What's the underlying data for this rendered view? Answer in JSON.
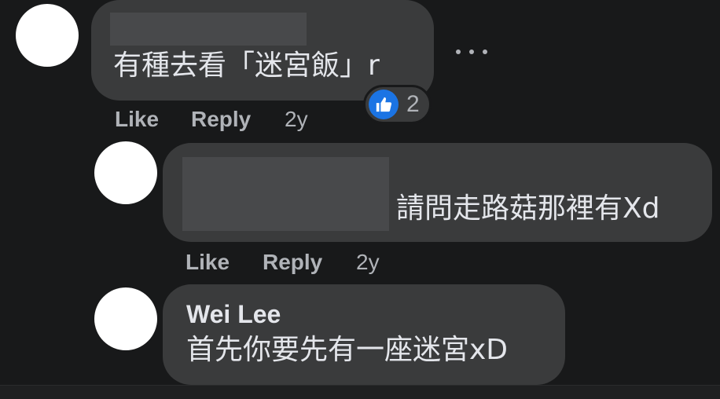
{
  "colors": {
    "background": "#18191a",
    "bubble": "#3a3b3c",
    "text_primary": "#e4e6eb",
    "text_secondary": "#b0b3b8",
    "like_blue": "#1b74e4"
  },
  "comments": [
    {
      "author": "",
      "text": "有種去看「迷宮飯」r",
      "author_redacted": true,
      "reaction": {
        "icon": "like-thumb-icon",
        "count": "2"
      },
      "actions": {
        "like": "Like",
        "reply": "Reply",
        "time": "2y"
      }
    },
    {
      "author": "",
      "text": "請問走路菇那裡有Xd",
      "author_redacted": true,
      "actions": {
        "like": "Like",
        "reply": "Reply",
        "time": "2y"
      }
    },
    {
      "author": "Wei Lee",
      "text": "首先你要先有一座迷宮xD"
    }
  ],
  "more_icon": "more-dots-icon"
}
